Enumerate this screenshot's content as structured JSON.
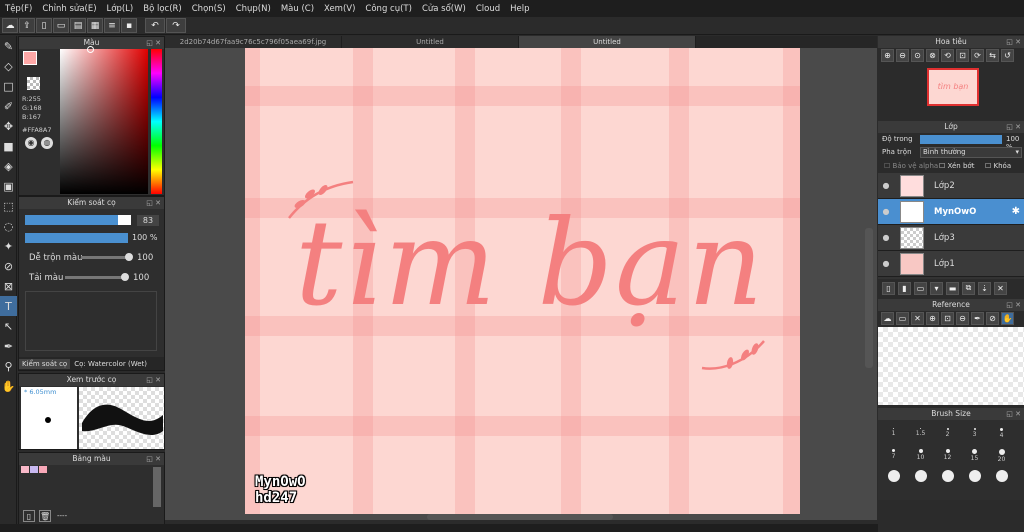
{
  "menu": [
    "Tệp(F)",
    "Chỉnh sửa(E)",
    "Lớp(L)",
    "Bộ lọc(R)",
    "Chọn(S)",
    "Chụp(N)",
    "Màu (C)",
    "Xem(V)",
    "Công cụ(T)",
    "Cửa sổ(W)",
    "Cloud",
    "Help"
  ],
  "tabs": [
    "2d20b74d67faa9c76c5c796f05aea69f.jpg",
    "Untitled",
    "Untitled"
  ],
  "color_panel": {
    "title": "Màu",
    "r": "R:255",
    "g": "G:168",
    "b": "B:167",
    "hex": "#FFA8A7",
    "fg_color": "#ffa8a7"
  },
  "brush_control": {
    "title": "Kiểm soát cọ",
    "size": "83",
    "opacity": "100 %",
    "blend_label": "Dễ trộn màu",
    "blend_value": "100",
    "reload_label": "Tải màu",
    "reload_value": "100",
    "tab_label": "Kiểm soát cọ",
    "brush_name": "Cọ: Watercolor (Wet)"
  },
  "preview": {
    "title": "Xem trước cọ",
    "size": "* 6.05mm"
  },
  "palette": {
    "title": "Bảng màu",
    "swatches": [
      "#f8b8c8",
      "#c8b8f0",
      "#f8a8b8"
    ],
    "footer": "----"
  },
  "navigator": {
    "title": "Hoa tiêu"
  },
  "layer_panel": {
    "title": "Lớp",
    "opacity_label": "Độ trong",
    "opacity_value": "100 %",
    "blend_label": "Pha trộn",
    "blend_value": "Bình thường",
    "protect_alpha": "Bảo vệ alpha",
    "clipping": "Xén bớt",
    "lock": "Khóa",
    "layers": [
      {
        "name": "Lớp2",
        "active": false
      },
      {
        "name": "MynOwO",
        "active": true
      },
      {
        "name": "Lớp3",
        "active": false
      },
      {
        "name": "Lớp1",
        "active": false
      }
    ]
  },
  "reference": {
    "title": "Reference"
  },
  "brush_size": {
    "title": "Brush Size",
    "sizes": [
      "1",
      "1.5",
      "2",
      "3",
      "4",
      "7",
      "10",
      "12",
      "15",
      "20"
    ]
  },
  "canvas_text": {
    "main": "tìm bạn",
    "sig1": "MynOwO",
    "sig2": "hd247"
  }
}
